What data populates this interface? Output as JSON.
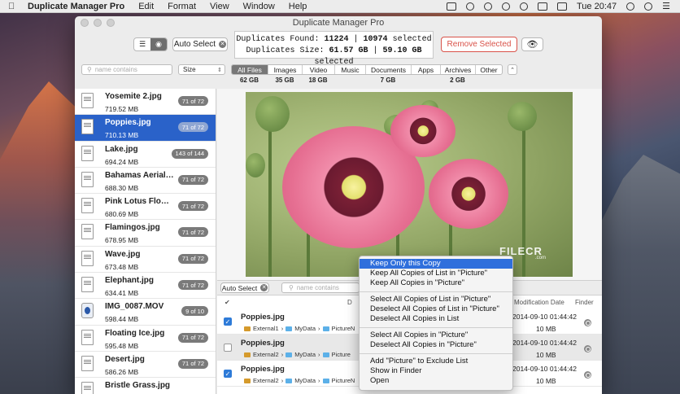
{
  "menubar": {
    "app_name": "Duplicate Manager Pro",
    "menus": [
      "Edit",
      "Format",
      "View",
      "Window",
      "Help"
    ],
    "clock": "Tue 20:47"
  },
  "window": {
    "title": "Duplicate Manager Pro"
  },
  "toolbar": {
    "auto_select_label": "Auto Select",
    "stats_line1_label": "Duplicates Found:",
    "stats_found": "11224",
    "stats_found_sep": "|",
    "stats_selected_count": "10974",
    "stats_selected_label": "selected",
    "stats_line2_label": "Duplicates Size:",
    "stats_size": "61.57 GB",
    "stats_selected_size": "59.10 GB",
    "remove_label": "Remove Selected"
  },
  "filters": {
    "name_placeholder": "name contains",
    "size_option": "Size",
    "categories": [
      {
        "label": "All Files",
        "size": "62 GB",
        "active": true
      },
      {
        "label": "Images",
        "size": "35 GB",
        "active": false
      },
      {
        "label": "Video",
        "size": "18 GB",
        "active": false
      },
      {
        "label": "Music",
        "size": "",
        "active": false
      },
      {
        "label": "Documents",
        "size": "7 GB",
        "active": false
      },
      {
        "label": "Apps",
        "size": "",
        "active": false
      },
      {
        "label": "Archives",
        "size": "2 GB",
        "active": false
      },
      {
        "label": "Other",
        "size": "",
        "active": false
      }
    ]
  },
  "files": [
    {
      "name": "Yosemite 2.jpg",
      "size": "719.52 MB",
      "copies": "71 of 72",
      "selected": false,
      "kind": "doc"
    },
    {
      "name": "Poppies.jpg",
      "size": "710.13 MB",
      "copies": "71 of 72",
      "selected": true,
      "kind": "doc"
    },
    {
      "name": "Lake.jpg",
      "size": "694.24 MB",
      "copies": "143 of 144",
      "selected": false,
      "kind": "doc"
    },
    {
      "name": "Bahamas Aerial.jpg",
      "size": "688.30 MB",
      "copies": "71 of 72",
      "selected": false,
      "kind": "doc"
    },
    {
      "name": "Pink Lotus Flower....",
      "size": "680.69 MB",
      "copies": "71 of 72",
      "selected": false,
      "kind": "doc"
    },
    {
      "name": "Flamingos.jpg",
      "size": "678.95 MB",
      "copies": "71 of 72",
      "selected": false,
      "kind": "doc"
    },
    {
      "name": "Wave.jpg",
      "size": "673.48 MB",
      "copies": "71 of 72",
      "selected": false,
      "kind": "doc"
    },
    {
      "name": "Elephant.jpg",
      "size": "634.41 MB",
      "copies": "71 of 72",
      "selected": false,
      "kind": "doc"
    },
    {
      "name": "IMG_0087.MOV",
      "size": "598.44 MB",
      "copies": "9 of 10",
      "selected": false,
      "kind": "movie"
    },
    {
      "name": "Floating Ice.jpg",
      "size": "595.48 MB",
      "copies": "71 of 72",
      "selected": false,
      "kind": "doc"
    },
    {
      "name": "Desert.jpg",
      "size": "586.26 MB",
      "copies": "71 of 72",
      "selected": false,
      "kind": "doc"
    },
    {
      "name": "Bristle Grass.jpg",
      "size": "",
      "copies": "",
      "selected": false,
      "kind": "doc"
    }
  ],
  "preview": {
    "watermark": "FILECR",
    "watermark_sub": ".com"
  },
  "lower": {
    "auto_select_label": "Auto Select",
    "search_placeholder": "name contains",
    "col_check": "✔",
    "col_d": "D",
    "col_modification_date": "Modification Date",
    "col_finder": "Finder",
    "rows": [
      {
        "name": "Poppies.jpg",
        "checked": true,
        "path": [
          "External1",
          "MyData",
          "PictureN"
        ],
        "date": "2014-09-10 01:44:42",
        "size": "10 MB"
      },
      {
        "name": "Poppies.jpg",
        "checked": false,
        "path": [
          "External2",
          "MyData",
          "Picture"
        ],
        "date": "2014-09-10 01:44:42",
        "size": "10 MB"
      },
      {
        "name": "Poppies.jpg",
        "checked": true,
        "path": [
          "External2",
          "MyData",
          "PictureN"
        ],
        "date": "2014-09-10 01:44:42",
        "size": "10 MB"
      }
    ]
  },
  "context_menu": {
    "groups": [
      [
        "Keep Only this Copy",
        "Keep All Copies of List in \"Picture\"",
        "Keep All Copies in \"Picture\""
      ],
      [
        "Select All Copies of List in \"Picture\"",
        "Deselect All Copies of List in \"Picture\"",
        "Deselect All Copies in List"
      ],
      [
        "Select All Copies in \"Picture\"",
        "Deselect All Copies in \"Picture\""
      ],
      [
        "Add \"Picture\" to Exclude List",
        "Show in Finder",
        "Open"
      ]
    ]
  },
  "colors": {
    "selection": "#2a62c9",
    "remove_red": "#d9534a",
    "menu_highlight": "#2f6fdc",
    "checkbox_blue": "#2e7bd8"
  }
}
